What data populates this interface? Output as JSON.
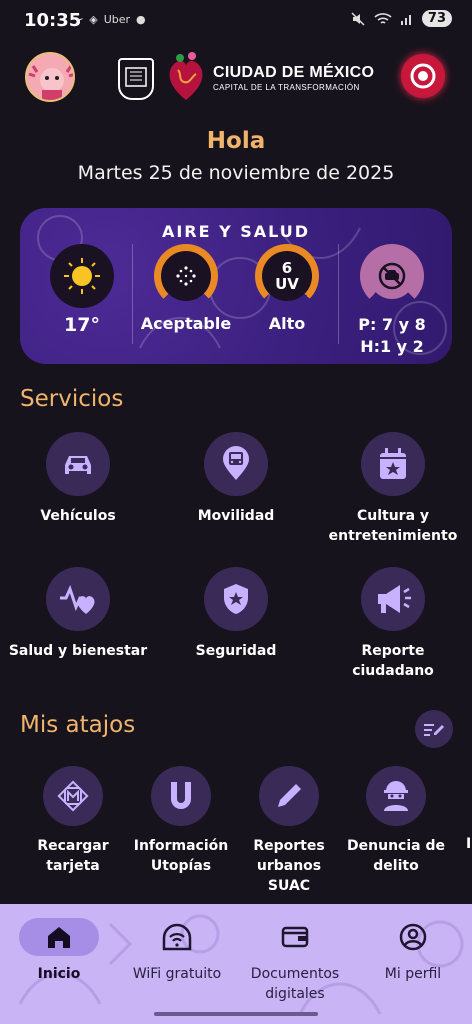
{
  "status_bar": {
    "time": "10:35",
    "carrier_badge": "Uber",
    "battery": "73"
  },
  "header": {
    "brand_title": "CIUDAD DE MÉXICO",
    "brand_subtitle": "CAPITAL DE LA TRANSFORMACIÓN"
  },
  "greeting": "Hola",
  "date": "Martes 25 de noviembre de 2025",
  "air_health": {
    "title": "AIRE Y SALUD",
    "temperature": "17°",
    "air_quality": "Aceptable",
    "uv_value": "6",
    "uv_unit": "UV",
    "uv_level": "Alto",
    "plates_line1": "P: 7 y 8",
    "plates_line2": "H:1 y 2"
  },
  "services": {
    "title": "Servicios",
    "items": [
      {
        "label": "Vehículos"
      },
      {
        "label": "Movilidad"
      },
      {
        "label": "Cultura y entretenimiento"
      },
      {
        "label": "Salud y bienestar"
      },
      {
        "label": "Seguridad"
      },
      {
        "label": "Reporte ciudadano"
      }
    ]
  },
  "shortcuts": {
    "title": "Mis atajos",
    "items": [
      {
        "label": "Recargar tarjeta"
      },
      {
        "label": "Información Utopías"
      },
      {
        "label": "Reportes urbanos SUAC"
      },
      {
        "label": "Denuncia de delito"
      },
      {
        "label": "I"
      }
    ]
  },
  "bottom_nav": {
    "items": [
      {
        "label": "Inicio",
        "icon": "home-icon"
      },
      {
        "label": "WiFi gratuito",
        "icon": "wifi-icon"
      },
      {
        "label": "Documentos digitales",
        "icon": "wallet-icon"
      },
      {
        "label": "Mi perfil",
        "icon": "profile-icon"
      }
    ]
  },
  "colors": {
    "background": "#17131c",
    "accent_gold": "#f1b46b",
    "card_purple": "#3a1f7d",
    "icon_circle": "#3a2a58",
    "icon_lavender": "#c8b2ff",
    "nav_background": "#c9b4f5",
    "gauge_orange": "#e98a25",
    "gauge_pink": "#b56fa6",
    "alert_red": "#c7173a"
  }
}
